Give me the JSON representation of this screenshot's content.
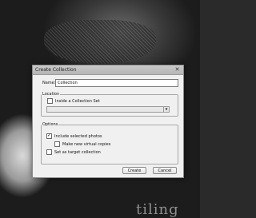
{
  "background": {
    "photo_text": "tiling"
  },
  "dialog": {
    "title": "Create Collection",
    "close_glyph": "✕",
    "name_label": "Name:",
    "name_value": "Collection",
    "location": {
      "label": "Location",
      "inside_set_label": "Inside a Collection Set",
      "inside_set_checked": false,
      "set_select_value": ""
    },
    "options": {
      "label": "Options",
      "include_selected_label": "Include selected photos",
      "include_selected_checked": true,
      "virtual_copies_label": "Make new virtual copies",
      "virtual_copies_checked": false,
      "target_collection_label": "Set as target collection",
      "target_collection_checked": false
    },
    "buttons": {
      "create_label": "Create",
      "cancel_label": "Cancel"
    }
  },
  "colors": {
    "dialog_bg": "#f0f0f0",
    "titlebar": "#bfbfbf",
    "border": "#8a8a8a"
  }
}
